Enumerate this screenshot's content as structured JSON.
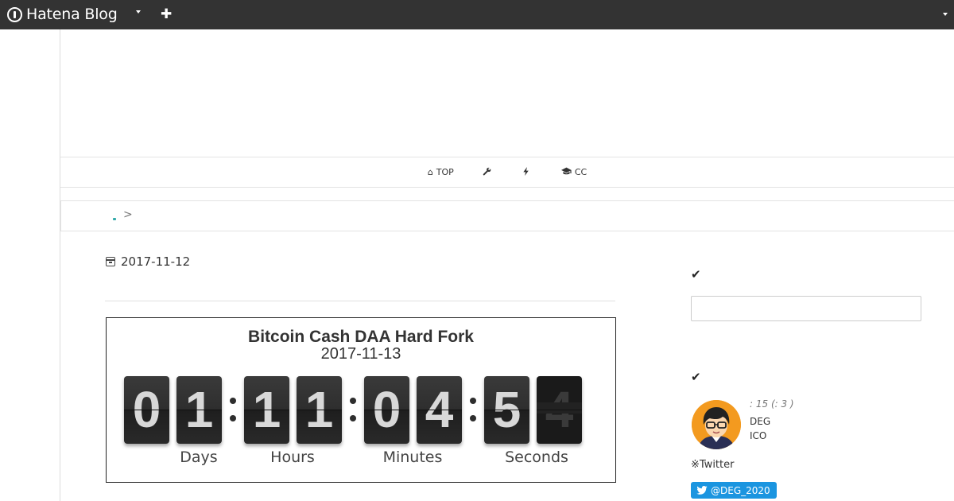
{
  "topbar": {
    "logo_text": "Hatena Blog",
    "add_label": "✚"
  },
  "nav": {
    "items": [
      {
        "icon": "home-icon",
        "glyph": "⌂",
        "label": "TOP"
      },
      {
        "icon": "wrench-icon",
        "glyph": "🔧",
        "label": ""
      },
      {
        "icon": "bolt-icon",
        "glyph": "ϟ",
        "label": ""
      },
      {
        "icon": "graduation-cap-icon",
        "glyph": "🎓",
        "label": "CC"
      }
    ]
  },
  "breadcrumb": {
    "separator": ">"
  },
  "entry": {
    "date": "2017-11-12"
  },
  "countdown": {
    "title": "Bitcoin Cash DAA Hard Fork",
    "date": "2017-11-13",
    "days": [
      "0",
      "1"
    ],
    "hours": [
      "1",
      "1"
    ],
    "minutes": [
      "0",
      "4"
    ],
    "seconds": [
      "5",
      "4"
    ],
    "labels": {
      "days": "Days",
      "hours": "Hours",
      "minutes": "Minutes",
      "seconds": "Seconds"
    }
  },
  "sidebar": {
    "check_glyph": "✔",
    "profile": {
      "stats": ":        15 (:        3 )",
      "name": "DEG",
      "desc": "ICO"
    },
    "twitter_note": "※Twitter",
    "twitter_button": "@DEG_2020"
  },
  "colors": {
    "topbar": "#333333",
    "twitter": "#1b95e0",
    "avatar_bg": "#f39a1f"
  }
}
